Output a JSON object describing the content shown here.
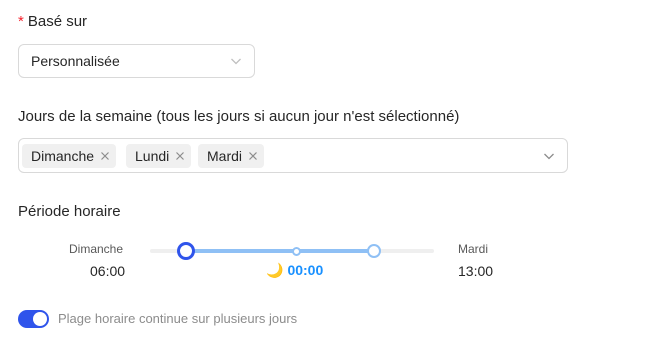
{
  "based_on": {
    "required_mark": "*",
    "label": "Basé sur",
    "value": "Personnalisée"
  },
  "weekdays": {
    "label": "Jours de la semaine (tous les jours si aucun jour n'est sélectionné)",
    "tags": [
      {
        "label": "Dimanche"
      },
      {
        "label": "Lundi"
      },
      {
        "label": "Mardi"
      }
    ]
  },
  "time_period": {
    "label": "Période horaire",
    "start_day": "Dimanche",
    "start_time": "06:00",
    "end_day": "Mardi",
    "end_time": "13:00",
    "midnight_marker": "00:00"
  },
  "continuous": {
    "enabled": true,
    "label": "Plage horaire continue sur plusieurs jours"
  },
  "colors": {
    "accent": "#2f54eb",
    "range": "#8fc0f5",
    "midnight_text": "#1890ff",
    "required": "#f5222d"
  },
  "icons": {
    "select_arrow": "chevron-down-icon",
    "tag_remove": "close-icon",
    "midnight": "moon-icon"
  }
}
